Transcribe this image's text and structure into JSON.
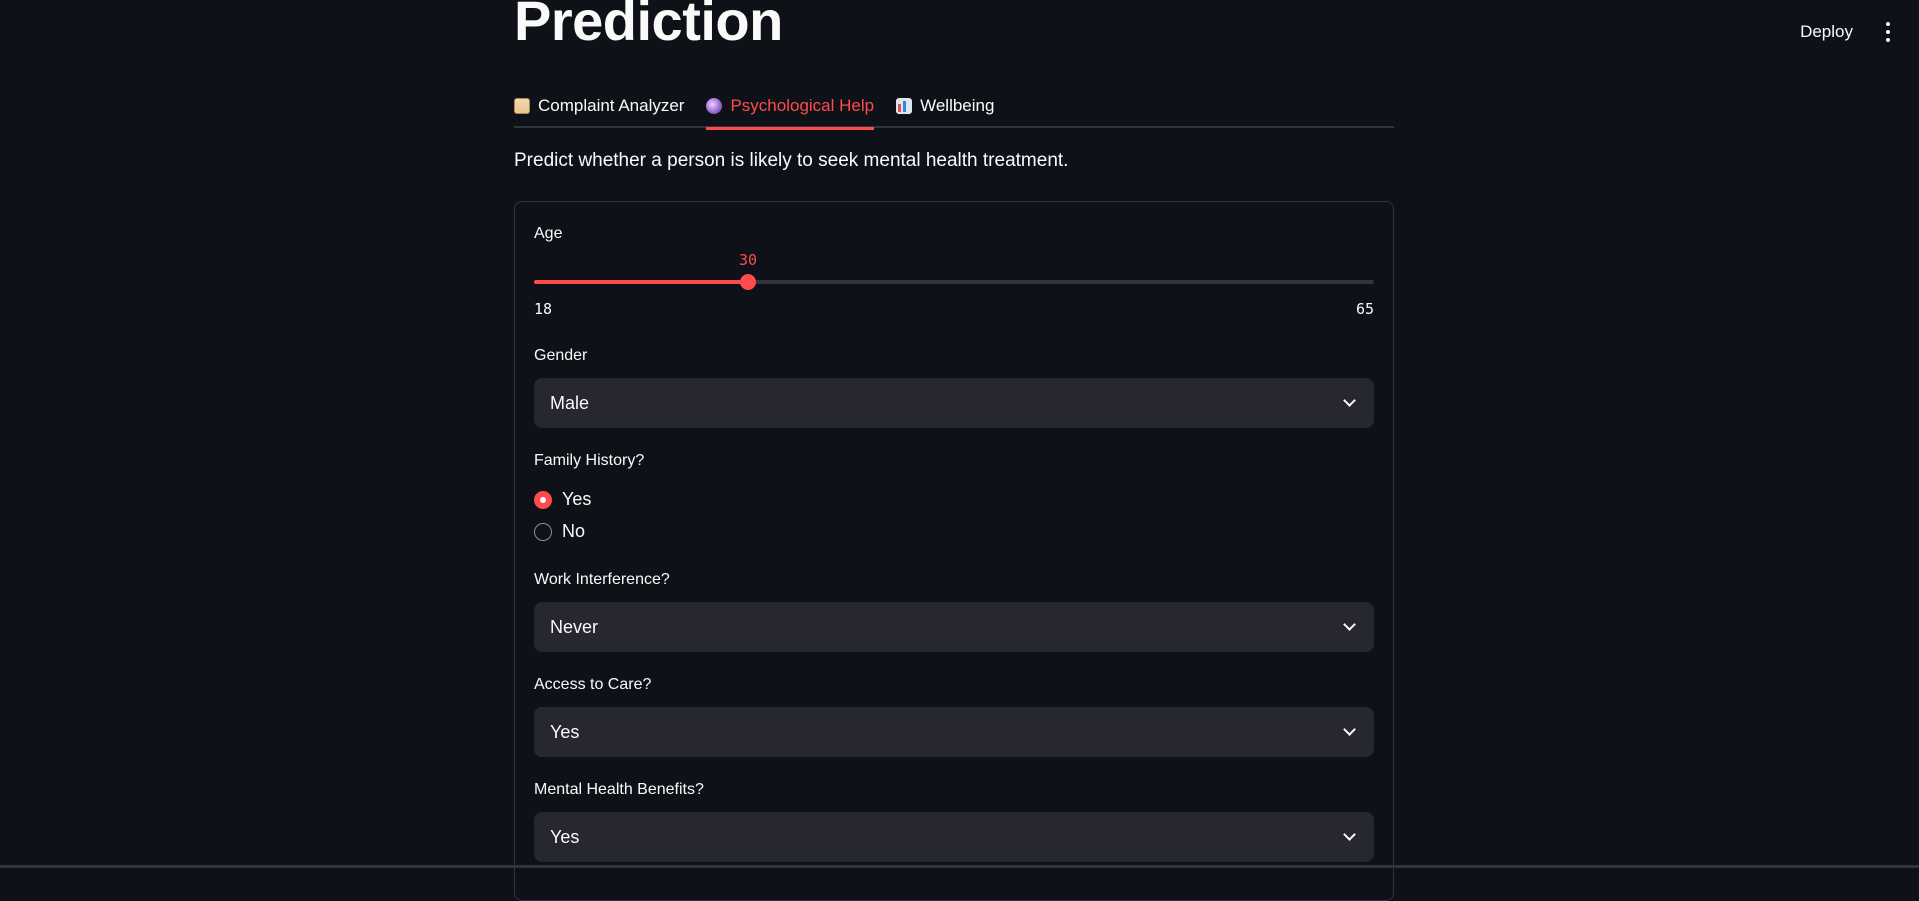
{
  "header": {
    "deploy_label": "Deploy",
    "menu_icon": "kebab-menu-icon"
  },
  "page": {
    "title": "Prediction",
    "description": "Predict whether a person is likely to seek mental health treatment."
  },
  "tabs": [
    {
      "label": "Complaint Analyzer",
      "icon": "clipboard-icon",
      "active": false
    },
    {
      "label": "Psychological Help",
      "icon": "crystal-ball-icon",
      "active": true
    },
    {
      "label": "Wellbeing",
      "icon": "bar-chart-icon",
      "active": false
    }
  ],
  "form": {
    "age": {
      "label": "Age",
      "value": "30",
      "min": "18",
      "max": "65",
      "fraction": 0.2553
    },
    "gender": {
      "label": "Gender",
      "selected": "Male"
    },
    "family_history": {
      "label": "Family History?",
      "options": [
        "Yes",
        "No"
      ],
      "selected": "Yes"
    },
    "work_interference": {
      "label": "Work Interference?",
      "selected": "Never"
    },
    "access_to_care": {
      "label": "Access to Care?",
      "selected": "Yes"
    },
    "mental_health_benefits": {
      "label": "Mental Health Benefits?",
      "selected": "Yes"
    }
  },
  "colors": {
    "accent": "#ff4b4b",
    "background": "#0e1117",
    "input_bg": "#262730"
  }
}
